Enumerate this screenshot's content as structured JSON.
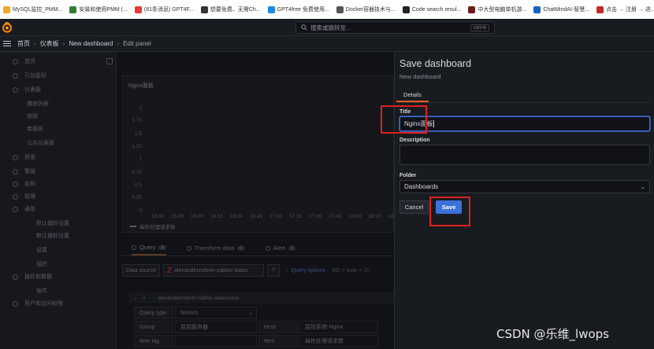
{
  "bookmarks": [
    {
      "label": "MySQL监控_PMM...",
      "color": "#f3a623"
    },
    {
      "label": "安装和使用PMM (...",
      "color": "#2e7d32"
    },
    {
      "label": "(81条消息) GPT4F...",
      "color": "#e53935"
    },
    {
      "label": "想要免费、无需Ch...",
      "color": "#333333"
    },
    {
      "label": "GPT4free 免费使用...",
      "color": "#1e88e5"
    },
    {
      "label": "Docker容器技术与...",
      "color": "#555555"
    },
    {
      "label": "Code search resul...",
      "color": "#222222"
    },
    {
      "label": "中大型电脑单机游...",
      "color": "#6d1a1a"
    },
    {
      "label": "ChatMindAI-智慧...",
      "color": "#1565c0"
    },
    {
      "label": "点击 → 注册 → 进...",
      "color": "#c62828"
    },
    {
      "label": "All",
      "color": "#999999"
    }
  ],
  "topnav": {
    "search_placeholder": "搜索或跳转至...",
    "shortcut": "ctrl+k"
  },
  "breadcrumb": [
    "首页",
    "仪表板",
    "New dashboard",
    "Edit panel"
  ],
  "background": {
    "sidebar_items": [
      "首页",
      "已加星标",
      "仪表板",
      "播放列表",
      "快照",
      "库面板",
      "公共仪表板",
      "探索",
      "警报",
      "告知",
      "管理",
      "通用",
      "默认偏好设置",
      "默认偏好设置",
      "设置",
      "组织",
      "插件和数据",
      "插件",
      "用户和访问权限"
    ],
    "panel_title": "Nginx面板",
    "y_ticks": [
      "2",
      "1.75",
      "1.5",
      "1.25",
      "1",
      "0.75",
      "0.5",
      "0.25",
      "0"
    ],
    "x_ticks": [
      "15:30",
      "15:45",
      "16:00",
      "16:15",
      "16:30",
      "16:45",
      "17:00",
      "17:15",
      "17:30",
      "17:45",
      "18:00",
      "18:15",
      "18:"
    ],
    "legend": "每秒处理请求数",
    "tabs": [
      {
        "label": "Query",
        "count": "1"
      },
      {
        "label": "Transform data",
        "count": "0"
      },
      {
        "label": "Alert",
        "count": "0"
      }
    ],
    "data_source_label": "Data source",
    "data_source_value": "alexanderzobnin-zabbix-datas",
    "query_options": "Query options",
    "query_options_meta": "MD = auto = 1h",
    "query_letter": "A",
    "query_source": "alexanderzobnin-zabbix-datasource",
    "query_type_label": "Query type",
    "query_type_value": "Metrics",
    "group_label": "Group",
    "group_value": "监控服务器",
    "host_label": "Host",
    "host_value": "监控系统-Nginx",
    "item_tag_label": "Item tag",
    "item_label": "Item",
    "item_value": "每秒处理请求数"
  },
  "drawer": {
    "title": "Save dashboard",
    "subtitle": "New dashboard",
    "tab": "Details",
    "title_label": "Title",
    "title_value": "Nginx面板",
    "description_label": "Description",
    "description_value": "",
    "folder_label": "Folder",
    "folder_value": "Dashboards",
    "cancel_label": "Cancel",
    "save_label": "Save"
  },
  "watermark": "CSDN @乐维_lwops",
  "colors": {
    "accent_blue": "#3d71d9",
    "highlight_red": "#e02020",
    "tab_orange": "#f05a28"
  }
}
